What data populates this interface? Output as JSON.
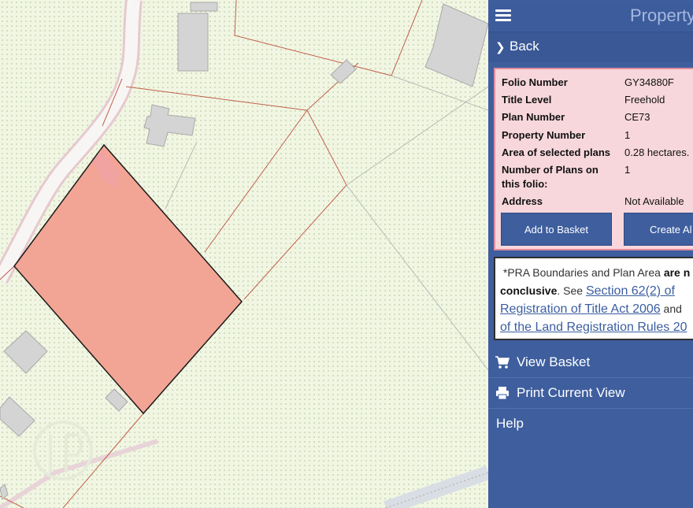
{
  "panel": {
    "title": "Property",
    "back_label": "Back"
  },
  "info": {
    "rows": [
      {
        "label": "Folio Number",
        "value": "GY34880F"
      },
      {
        "label": "Title Level",
        "value": "Freehold"
      },
      {
        "label": "Plan Number",
        "value": "CE73"
      },
      {
        "label": "Property Number",
        "value": "1"
      },
      {
        "label": "Area of selected plans",
        "value": "0.28 hectares."
      },
      {
        "label": "Number of Plans on this folio:",
        "value": "1"
      },
      {
        "label": "Address",
        "value": "Not Available"
      }
    ],
    "add_to_basket": "Add to Basket",
    "create_alert": "Create Al"
  },
  "disclaimer": {
    "line1_prefix": "*PRA Boundaries and Plan Area ",
    "line1_bold": "are n",
    "line2_bold": "conclusive",
    "line2_rest": ". See ",
    "link1_part1": "Section 62(2) of",
    "link1_part2": "Registration of Title Act 2006",
    "and_text": " and",
    "link2": "of the Land Registration Rules 20"
  },
  "menu": {
    "view_basket": "View Basket",
    "print_view": "Print Current View",
    "help": "Help"
  },
  "colors": {
    "panel_bg": "#3e5e9e",
    "info_bg": "#f7d7dc",
    "info_border": "#e48d9b",
    "selected_parcel": "#f3a595",
    "map_bg": "#f1f6e3",
    "boundary": "#c0604a"
  },
  "icons": {
    "hamburger": "hamburger-menu-icon",
    "back": "chevron-right-icon",
    "basket": "shopping-cart-icon",
    "print": "printer-icon"
  }
}
